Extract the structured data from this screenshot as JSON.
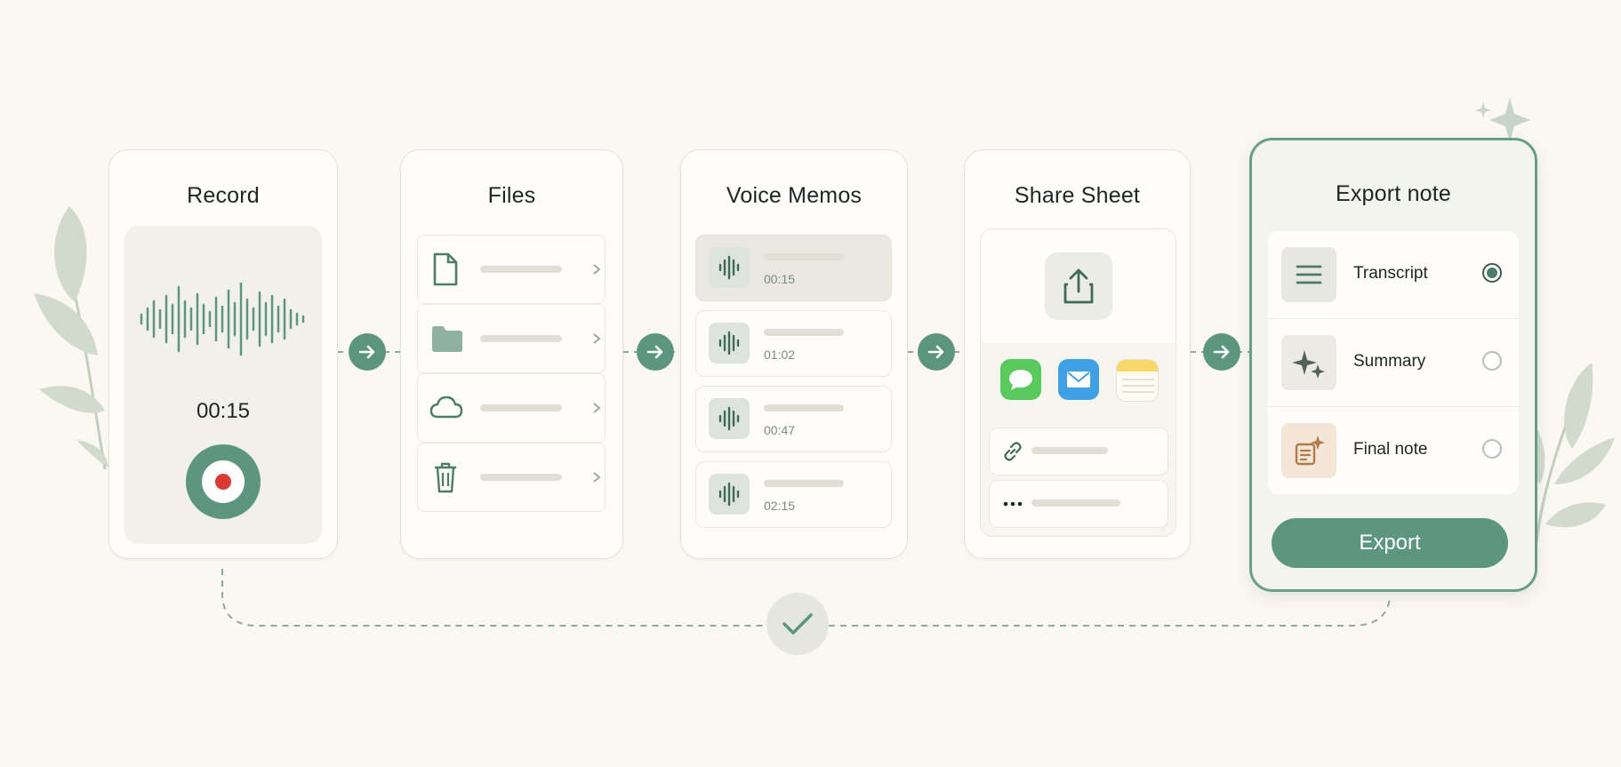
{
  "steps": {
    "record": {
      "title": "Record",
      "timer": "00:15"
    },
    "files": {
      "title": "Files"
    },
    "memos": {
      "title": "Voice Memos",
      "items": [
        {
          "duration": "00:15",
          "selected": true
        },
        {
          "duration": "01:02",
          "selected": false
        },
        {
          "duration": "00:47",
          "selected": false
        },
        {
          "duration": "02:15",
          "selected": false
        }
      ]
    },
    "share": {
      "title": "Share Sheet"
    },
    "export": {
      "title": "Export note",
      "options": [
        {
          "label": "Transcript",
          "checked": true
        },
        {
          "label": "Summary",
          "checked": false
        },
        {
          "label": "Final note",
          "checked": false
        }
      ],
      "button_label": "Export"
    }
  },
  "icons": {
    "files_rows": [
      "document-icon",
      "folder-icon",
      "cloud-icon",
      "trash-icon"
    ],
    "share_apps": [
      "messages-icon",
      "mail-icon",
      "notes-icon"
    ],
    "share_rows": [
      "link-icon",
      "more-icon"
    ],
    "export_options": [
      "list-icon",
      "sparkles-icon",
      "note-sparkle-icon"
    ]
  },
  "colors": {
    "accent": "#5d9680",
    "background": "#fbf8f2",
    "record_dot": "#d93a34",
    "messages": "#5ac95e",
    "mail": "#3fa0e3",
    "notes": "#f7d868"
  }
}
